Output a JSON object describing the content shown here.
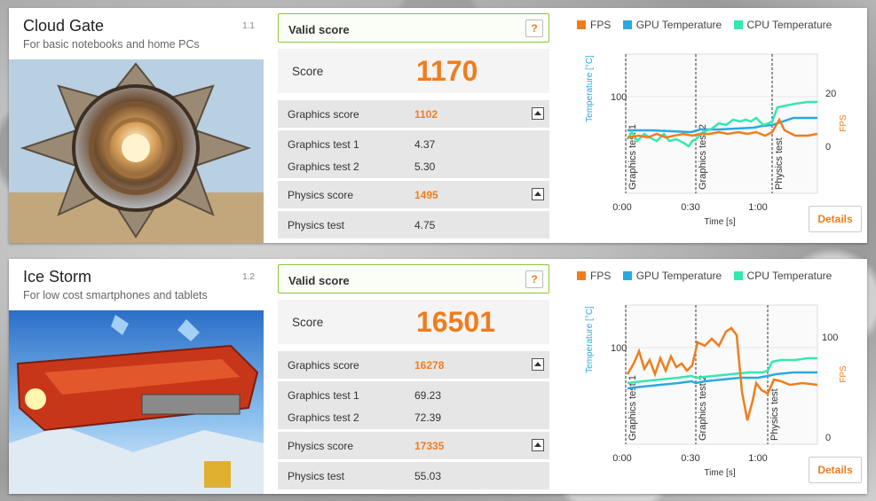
{
  "colors": {
    "accent": "#f07d1c",
    "valid_border": "#8cc63f",
    "fps": "#f07d1c",
    "gpu": "#29a9e1",
    "cpu": "#33e8b0"
  },
  "tests": [
    {
      "title": "Cloud Gate",
      "subtitle": "For basic notebooks and home PCs",
      "version": "1.1",
      "valid_label": "Valid score",
      "help_label": "?",
      "score_label": "Score",
      "score": "1170",
      "rows": [
        {
          "label": "Graphics score",
          "value": "1102"
        },
        {
          "label": "Graphics test 1",
          "value": "4.37"
        },
        {
          "label": "Graphics test 2",
          "value": "5.30"
        },
        {
          "label": "Physics score",
          "value": "1495"
        },
        {
          "label": "Physics test",
          "value": "4.75"
        }
      ],
      "legend": [
        "FPS",
        "GPU Temperature",
        "CPU Temperature"
      ],
      "details_label": "Details",
      "chart": {
        "y_left_label": "Temperature [°C]",
        "y_left_tick": "100",
        "y_right_label": "FPS",
        "y_right_ticks": [
          "20",
          "0"
        ],
        "x_label": "Time [s]",
        "x_ticks": [
          "0:00",
          "0:30",
          "1:00"
        ],
        "markers": [
          "Graphics test 1",
          "Graphics test 2",
          "Physics test"
        ]
      }
    },
    {
      "title": "Ice Storm",
      "subtitle": "For low cost smartphones and tablets",
      "version": "1.2",
      "valid_label": "Valid score",
      "help_label": "?",
      "score_label": "Score",
      "score": "16501",
      "rows": [
        {
          "label": "Graphics score",
          "value": "16278"
        },
        {
          "label": "Graphics test 1",
          "value": "69.23"
        },
        {
          "label": "Graphics test 2",
          "value": "72.39"
        },
        {
          "label": "Physics score",
          "value": "17335"
        },
        {
          "label": "Physics test",
          "value": "55.03"
        }
      ],
      "legend": [
        "FPS",
        "GPU Temperature",
        "CPU Temperature"
      ],
      "details_label": "Details",
      "chart": {
        "y_left_label": "Temperature [°C]",
        "y_left_tick": "100",
        "y_right_label": "FPS",
        "y_right_ticks": [
          "100",
          "0"
        ],
        "x_label": "Time [s]",
        "x_ticks": [
          "0:00",
          "0:30",
          "1:00"
        ],
        "markers": [
          "Graphics test 1",
          "Graphics test 2",
          "Physics test"
        ]
      }
    }
  ]
}
